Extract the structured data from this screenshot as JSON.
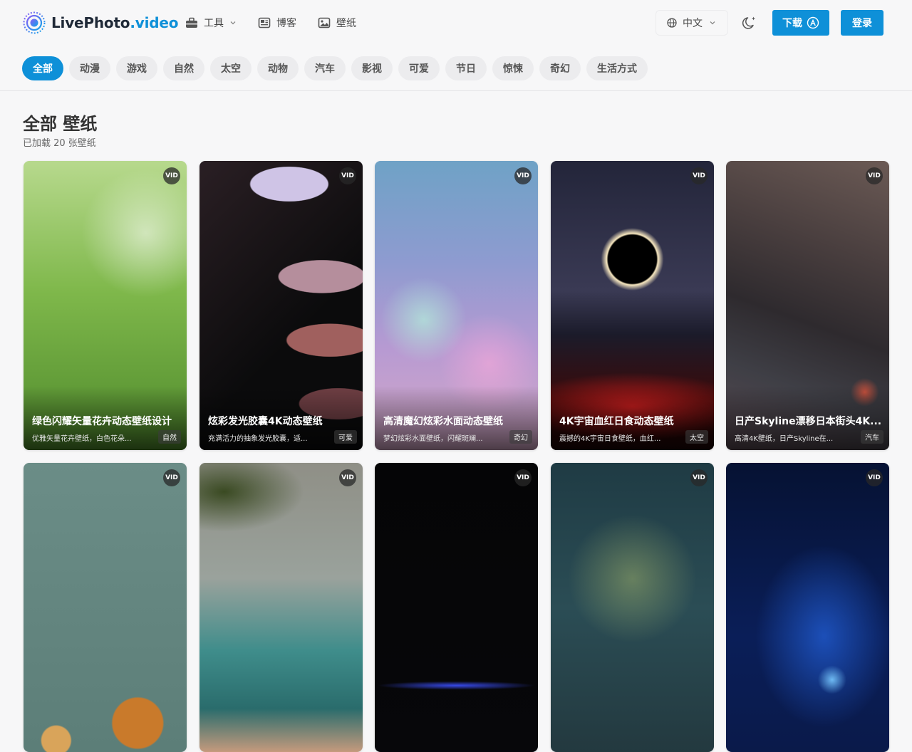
{
  "brand": {
    "name_main": "LivePhoto",
    "name_accent": ".video",
    "accent_color": "#0e90d8"
  },
  "nav": [
    {
      "label": "工具",
      "icon": "toolbox-icon",
      "has_dropdown": true
    },
    {
      "label": "博客",
      "icon": "newspaper-icon"
    },
    {
      "label": "壁纸",
      "icon": "image-icon"
    }
  ],
  "language": {
    "label": "中文"
  },
  "actions": {
    "download_label": "下载",
    "login_label": "登录"
  },
  "categories": [
    "全部",
    "动漫",
    "游戏",
    "自然",
    "太空",
    "动物",
    "汽车",
    "影视",
    "可爱",
    "节日",
    "惊悚",
    "奇幻",
    "生活方式"
  ],
  "active_category": "全部",
  "section": {
    "title": "全部 壁纸",
    "subtitle": "已加载 20 张壁纸"
  },
  "badge_label": "VID",
  "cards": [
    {
      "title": "绿色闪耀矢量花卉动态壁纸设计",
      "desc": "优雅矢量花卉壁纸，白色花朵...",
      "tag": "自然"
    },
    {
      "title": "炫彩发光胶囊4K动态壁纸",
      "desc": "充满活力的抽象发光胶囊，适...",
      "tag": "可爱"
    },
    {
      "title": "高清魔幻炫彩水面动态壁纸",
      "desc": "梦幻炫彩水面壁纸，闪耀斑斓...",
      "tag": "奇幻"
    },
    {
      "title": "4K宇宙血红日食动态壁纸",
      "desc": "震撼的4K宇宙日食壁纸，血红...",
      "tag": "太空"
    },
    {
      "title": "日产Skyline漂移日本街头4K...",
      "desc": "高清4K壁纸，日产Skyline在...",
      "tag": "汽车"
    },
    {
      "title": "",
      "desc": "",
      "tag": ""
    },
    {
      "title": "",
      "desc": "",
      "tag": ""
    },
    {
      "title": "",
      "desc": "",
      "tag": ""
    },
    {
      "title": "",
      "desc": "",
      "tag": ""
    },
    {
      "title": "",
      "desc": "",
      "tag": ""
    }
  ]
}
